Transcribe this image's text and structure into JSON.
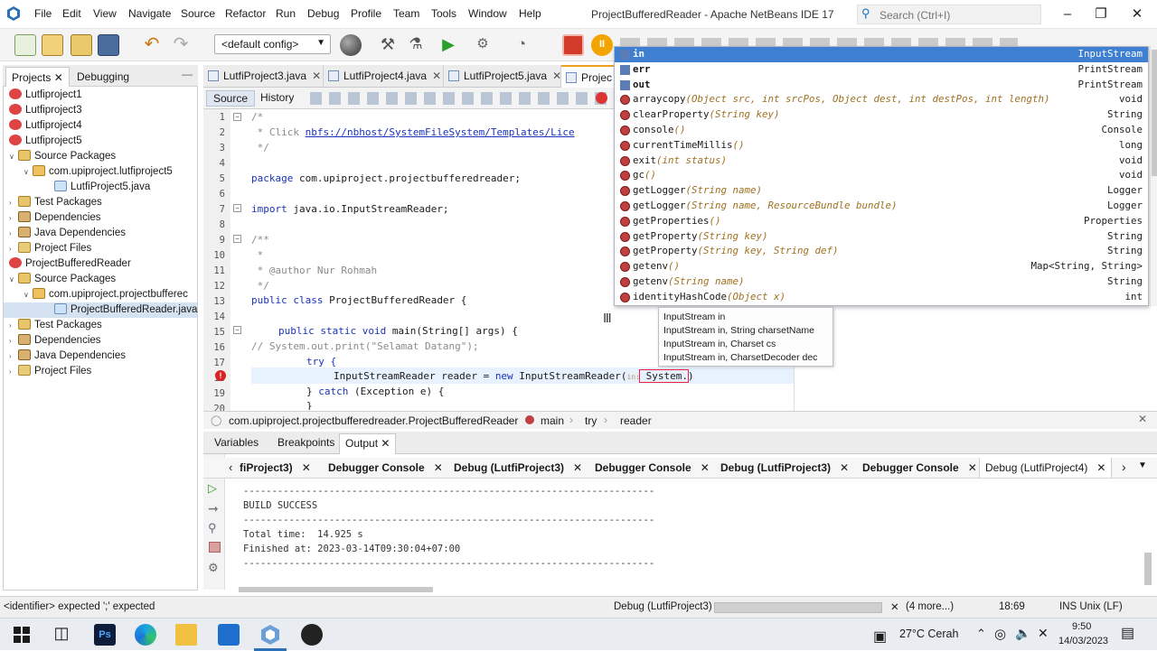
{
  "window": {
    "title": "ProjectBufferedReader - Apache NetBeans IDE 17",
    "menu": [
      "File",
      "Edit",
      "View",
      "Navigate",
      "Source",
      "Refactor",
      "Run",
      "Debug",
      "Profile",
      "Team",
      "Tools",
      "Window",
      "Help"
    ],
    "search_placeholder": "Search (Ctrl+I)"
  },
  "toolbar": {
    "config": "<default config>"
  },
  "left_panel": {
    "tabs": [
      "Projects",
      "Debugging"
    ],
    "tree": [
      {
        "label": "Lutfiproject1",
        "icon": "project-icon"
      },
      {
        "label": "Lutfiproject3",
        "icon": "project-icon"
      },
      {
        "label": "Lutfiproject4",
        "icon": "project-icon"
      },
      {
        "label": "Lutfiproject5",
        "icon": "project-icon"
      },
      {
        "label": "Source Packages",
        "icon": "source-packages-icon"
      },
      {
        "label": "com.upiproject.lutfiproject5",
        "icon": "package-icon"
      },
      {
        "label": "LutfiProject5.java",
        "icon": "java-file-icon"
      },
      {
        "label": "Test Packages",
        "icon": "test-packages-icon"
      },
      {
        "label": "Dependencies",
        "icon": "library-icon"
      },
      {
        "label": "Java Dependencies",
        "icon": "library-icon"
      },
      {
        "label": "Project Files",
        "icon": "folder-icon"
      },
      {
        "label": "ProjectBufferedReader",
        "icon": "project-icon"
      },
      {
        "label": "Source Packages",
        "icon": "source-packages-icon"
      },
      {
        "label": "com.upiproject.projectbufferec",
        "icon": "package-icon"
      },
      {
        "label": "ProjectBufferedReader.java",
        "icon": "java-file-icon"
      },
      {
        "label": "Test Packages",
        "icon": "test-packages-icon"
      },
      {
        "label": "Dependencies",
        "icon": "library-icon"
      },
      {
        "label": "Java Dependencies",
        "icon": "library-icon"
      },
      {
        "label": "Project Files",
        "icon": "folder-icon"
      }
    ]
  },
  "editor": {
    "tabs": [
      "LutfiProject3.java",
      "LutfiProject4.java",
      "LutfiProject5.java",
      "Projec"
    ],
    "source_tab": "Source",
    "history_tab": "History",
    "line_numbers": [
      "1",
      "2",
      "3",
      "4",
      "5",
      "6",
      "7",
      "8",
      "9",
      "10",
      "11",
      "12",
      "13",
      "14",
      "15",
      "16",
      "17",
      "18",
      "19",
      "20"
    ],
    "lines": {
      "l1": "/*",
      "l2a": " * Click ",
      "l2b": "nbfs://nbhost/SystemFileSystem/Templates/Lice",
      "l3": " */",
      "l5a": "package",
      "l5b": " com.upiproject.projectbufferedreader;",
      "l7a": "import",
      "l7b": " java.io.InputStreamReader;",
      "l9": "/**",
      "l10": " *",
      "l11": " * @author Nur Rohmah",
      "l12": " */",
      "l13a": "public class",
      "l13b": " ProjectBufferedReader {",
      "l15a": "public static void",
      "l15b": " main(String[] args) {",
      "l16": "// System.out.print(\"Selamat Datang\");",
      "l17": "try {",
      "l18a": "InputStreamReader reader = ",
      "l18b": "new",
      "l18c": " InputStreamReader(",
      "l18d": "in:",
      "l18e": " System.",
      "l18f": ")",
      "l19a": "} ",
      "l19b": "catch",
      "l19c": " (Exception e) {",
      "l20": "}"
    }
  },
  "completion": {
    "items": [
      {
        "name": "in",
        "params": "",
        "type": "InputStream",
        "kind": "field"
      },
      {
        "name": "err",
        "params": "",
        "type": "PrintStream",
        "kind": "field"
      },
      {
        "name": "out",
        "params": "",
        "type": "PrintStream",
        "kind": "field"
      },
      {
        "name": "arraycopy",
        "params": "(Object src, int srcPos, Object dest, int destPos, int length)",
        "type": "void",
        "kind": "method"
      },
      {
        "name": "clearProperty",
        "params": "(String key)",
        "type": "String",
        "kind": "method"
      },
      {
        "name": "console",
        "params": "()",
        "type": "Console",
        "kind": "method"
      },
      {
        "name": "currentTimeMillis",
        "params": "()",
        "type": "long",
        "kind": "method"
      },
      {
        "name": "exit",
        "params": "(int status)",
        "type": "void",
        "kind": "method"
      },
      {
        "name": "gc",
        "params": "()",
        "type": "void",
        "kind": "method"
      },
      {
        "name": "getLogger",
        "params": "(String name)",
        "type": "Logger",
        "kind": "method"
      },
      {
        "name": "getLogger",
        "params": "(String name, ResourceBundle bundle)",
        "type": "Logger",
        "kind": "method"
      },
      {
        "name": "getProperties",
        "params": "()",
        "type": "Properties",
        "kind": "method"
      },
      {
        "name": "getProperty",
        "params": "(String key)",
        "type": "String",
        "kind": "method"
      },
      {
        "name": "getProperty",
        "params": "(String key, String def)",
        "type": "String",
        "kind": "method"
      },
      {
        "name": "getenv",
        "params": "()",
        "type": "Map<String, String>",
        "kind": "method"
      },
      {
        "name": "getenv",
        "params": "(String name)",
        "type": "String",
        "kind": "method"
      },
      {
        "name": "identityHashCode",
        "params": "(Object x)",
        "type": "int",
        "kind": "method"
      }
    ],
    "hint": [
      "InputStream in",
      "InputStream in, String charsetName",
      "InputStream in, Charset cs",
      "InputStream in, CharsetDecoder dec"
    ]
  },
  "breadcrumb": [
    "com.upiproject.projectbufferedreader.ProjectBufferedReader",
    "main",
    "try",
    "reader"
  ],
  "output": {
    "panel_tabs": [
      "Variables",
      "Breakpoints",
      "Output"
    ],
    "tabs": [
      "fiProject3)",
      "Debugger Console",
      "Debug (LutfiProject3)",
      "Debugger Console",
      "Debug (LutfiProject3)",
      "Debugger Console",
      "Debug (LutfiProject4)"
    ],
    "lines": {
      "sep1": "------------------------------------------------------------------------",
      "build": "BUILD SUCCESS",
      "sep2": "------------------------------------------------------------------------",
      "total": "Total time:  14.925 s",
      "finished": "Finished at: 2023-03-14T09:30:04+07:00",
      "sep3": "------------------------------------------------------------------------"
    }
  },
  "status": {
    "message": "<identifier> expected  ';' expected",
    "task": "Debug (LutfiProject3)",
    "more": "(4 more...)",
    "position": "18:69",
    "mode": "INS Unix (LF)"
  },
  "taskbar": {
    "weather": "27°C  Cerah",
    "time": "9:50",
    "date": "14/03/2023"
  },
  "colors": {
    "selection": "#3f7fd2",
    "keyword": "#1a33bb",
    "comment": "#8a8a8a"
  }
}
